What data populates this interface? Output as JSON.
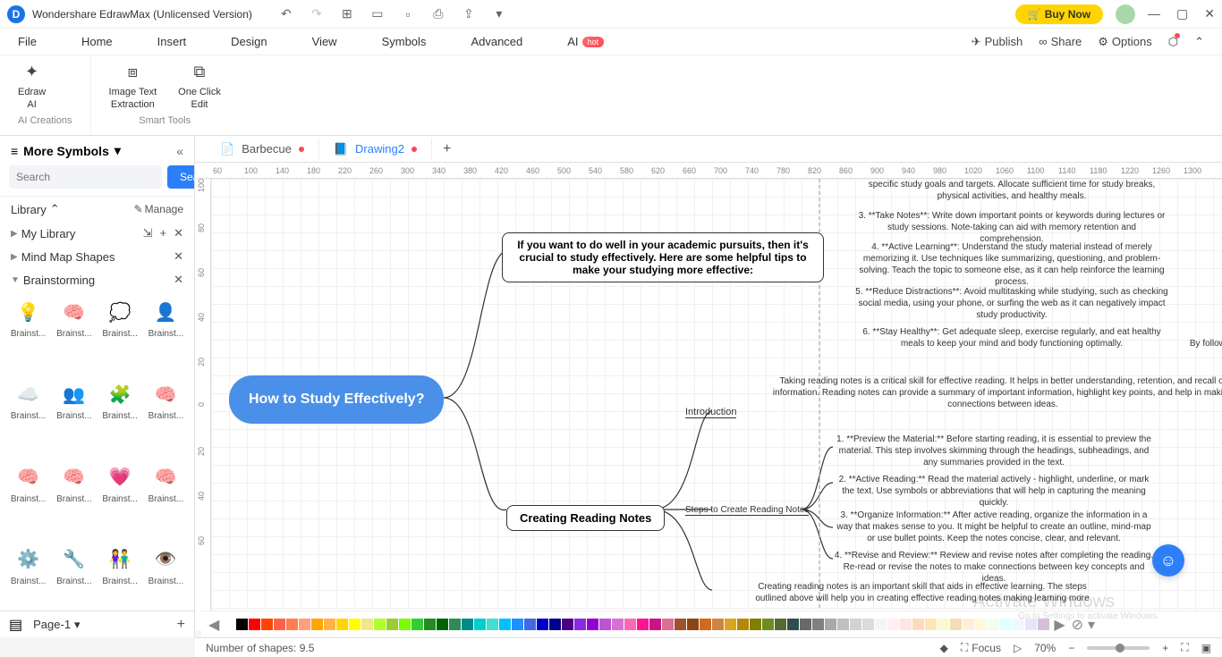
{
  "app": {
    "title": "Wondershare EdrawMax (Unlicensed Version)"
  },
  "titlebar": {
    "buy": "Buy Now"
  },
  "menu": {
    "items": [
      "File",
      "Home",
      "Insert",
      "Design",
      "View",
      "Symbols",
      "Advanced",
      "AI"
    ],
    "hot": "hot",
    "right": {
      "publish": "Publish",
      "share": "Share",
      "options": "Options"
    }
  },
  "ribbon": {
    "ai_creations": "AI Creations",
    "smart_tools": "Smart Tools",
    "edraw_ai": "Edraw\nAI",
    "image_text": "Image Text\nExtraction",
    "one_click": "One Click\nEdit"
  },
  "sidebar": {
    "more_symbols": "More Symbols",
    "search_ph": "Search",
    "search_btn": "Search",
    "library": "Library",
    "manage": "Manage",
    "my_library": "My Library",
    "mind_map": "Mind Map Shapes",
    "brainstorming": "Brainstorming",
    "shape_cap": "Brainst..."
  },
  "tabs": {
    "barbecue": "Barbecue",
    "drawing2": "Drawing2"
  },
  "ruler_h": [
    "60",
    "100",
    "140",
    "180",
    "220",
    "260",
    "300",
    "340",
    "380",
    "420",
    "460",
    "500",
    "540",
    "580",
    "620",
    "660",
    "700",
    "740",
    "780",
    "820",
    "860",
    "900",
    "940",
    "980",
    "1020",
    "1060",
    "1100",
    "1140",
    "1180",
    "1220",
    "1260",
    "1300"
  ],
  "ruler_v": [
    "100",
    "80",
    "60",
    "40",
    "20",
    "0",
    "20",
    "40",
    "60"
  ],
  "mind": {
    "root": "How to Study Effectively?",
    "intro_box": "If you want to do well in your academic pursuits, then it's crucial to study effectively. Here are some helpful tips to make your studying more effective:",
    "tip3": "3. **Take Notes**: Write down important points or keywords during lectures or study sessions. Note-taking can aid with memory retention and comprehension.",
    "tip4": "4. **Active Learning**: Understand the study material instead of merely memorizing it. Use techniques like summarizing, questioning, and problem-solving. Teach the topic to someone else, as it can help reinforce the learning process.",
    "tip5": "5. **Reduce Distractions**: Avoid multitasking while studying, such as checking social media, using your phone, or surfing the web as it can negatively impact study productivity.",
    "tip6": "6. **Stay Healthy**: Get adequate sleep, exercise regularly, and eat healthy meals to keep your mind and body functioning optimally.",
    "tip_extra": "specific study goals and targets. Allocate sufficient time for study breaks, physical activities, and healthy meals.",
    "by_follow": "By followi",
    "reading_intro": "Taking reading notes is a critical skill for effective reading. It helps in better understanding, retention, and recall of information. Reading notes can provide a summary of important information, highlight key points, and help in making connections between ideas.",
    "intro_label": "Introduction",
    "steps_label": "Steps to Create Reading Notes",
    "step1": "1. **Preview the Material:** Before starting reading, it is essential to preview the material. This step involves skimming through the headings, subheadings, and any summaries provided in the text.",
    "step2": "2. **Active Reading:** Read the material actively - highlight, underline, or mark the text. Use symbols or abbreviations that will help in capturing the meaning quickly.",
    "step3": "3. **Organize Information:** After active reading, organize the information in a way that makes sense to you. It might be helpful to create an outline, mind-map or use bullet points. Keep the notes concise, clear, and relevant.",
    "step4": "4. **Revise and Review:** Review and revise notes after completing the reading. Re-read or revise the notes to make connections between key concepts and ideas.",
    "creating_box": "Creating Reading Notes",
    "creating_outro": "Creating reading notes is an important skill that aids in effective learning. The steps outlined above will help you in creating effective reading notes making learning more"
  },
  "palette": [
    "#ffffff",
    "#000000",
    "#ff0000",
    "#ff4500",
    "#ff6347",
    "#ff7f50",
    "#ffa07a",
    "#ffa500",
    "#ffb347",
    "#ffd700",
    "#ffff00",
    "#f0e68c",
    "#adff2f",
    "#9acd32",
    "#7cfc00",
    "#32cd32",
    "#228b22",
    "#006400",
    "#2e8b57",
    "#008b8b",
    "#00ced1",
    "#40e0d0",
    "#00bfff",
    "#1e90ff",
    "#4169e1",
    "#0000cd",
    "#00008b",
    "#4b0082",
    "#8a2be2",
    "#9400d3",
    "#ba55d3",
    "#da70d6",
    "#ff69b4",
    "#ff1493",
    "#c71585",
    "#db7093",
    "#a0522d",
    "#8b4513",
    "#d2691e",
    "#cd853f",
    "#daa520",
    "#b8860b",
    "#808000",
    "#6b8e23",
    "#556b2f",
    "#2f4f4f",
    "#696969",
    "#808080",
    "#a9a9a9",
    "#c0c0c0",
    "#d3d3d3",
    "#dcdcdc",
    "#f5f5f5",
    "#fff0f5",
    "#ffe4e1",
    "#ffdab9",
    "#ffe4b5",
    "#fafad2",
    "#f5deb3",
    "#ffefd5",
    "#fff8dc",
    "#f0fff0",
    "#e0ffff",
    "#f0f8ff",
    "#e6e6fa",
    "#d8bfd8"
  ],
  "pages": {
    "tab": "Page-1",
    "indicator": "Page-1"
  },
  "status": {
    "shapes": "Number of shapes: 9.5",
    "focus": "Focus",
    "zoom": "70%"
  },
  "watermark": "Activate Windows",
  "watermark2": "Go to Settings to activate Windows."
}
